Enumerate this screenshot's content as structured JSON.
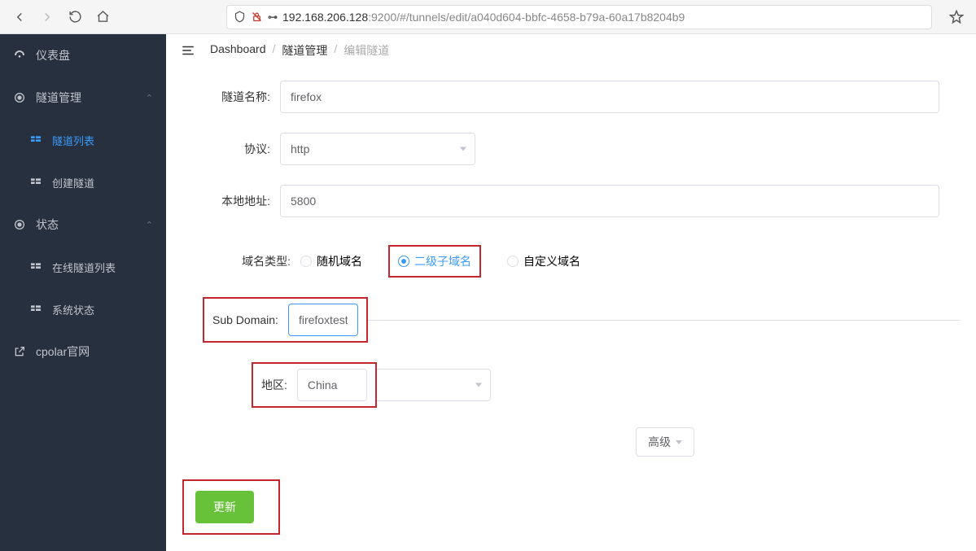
{
  "browser": {
    "url_host": "192.168.206.128",
    "url_rest": ":9200/#/tunnels/edit/a040d604-bbfc-4658-b79a-60a17b8204b9"
  },
  "sidebar": {
    "items": [
      {
        "label": "仪表盘"
      },
      {
        "label": "隧道管理"
      },
      {
        "label": "隧道列表"
      },
      {
        "label": "创建隧道"
      },
      {
        "label": "状态"
      },
      {
        "label": "在线隧道列表"
      },
      {
        "label": "系统状态"
      },
      {
        "label": "cpolar官网"
      }
    ]
  },
  "breadcrumb": {
    "a": "Dashboard",
    "b": "隧道管理",
    "c": "编辑隧道"
  },
  "form": {
    "tunnel_name_label": "隧道名称:",
    "tunnel_name_value": "firefox",
    "protocol_label": "协议:",
    "protocol_value": "http",
    "local_addr_label": "本地地址:",
    "local_addr_value": "5800",
    "domain_type_label": "域名类型:",
    "domain_type_options": [
      "随机域名",
      "二级子域名",
      "自定义域名"
    ],
    "domain_type_selected": "二级子域名",
    "subdomain_label": "Sub Domain:",
    "subdomain_value": "firefoxtest",
    "region_label": "地区:",
    "region_value": "China",
    "advanced_label": "高级",
    "submit_label": "更新"
  }
}
